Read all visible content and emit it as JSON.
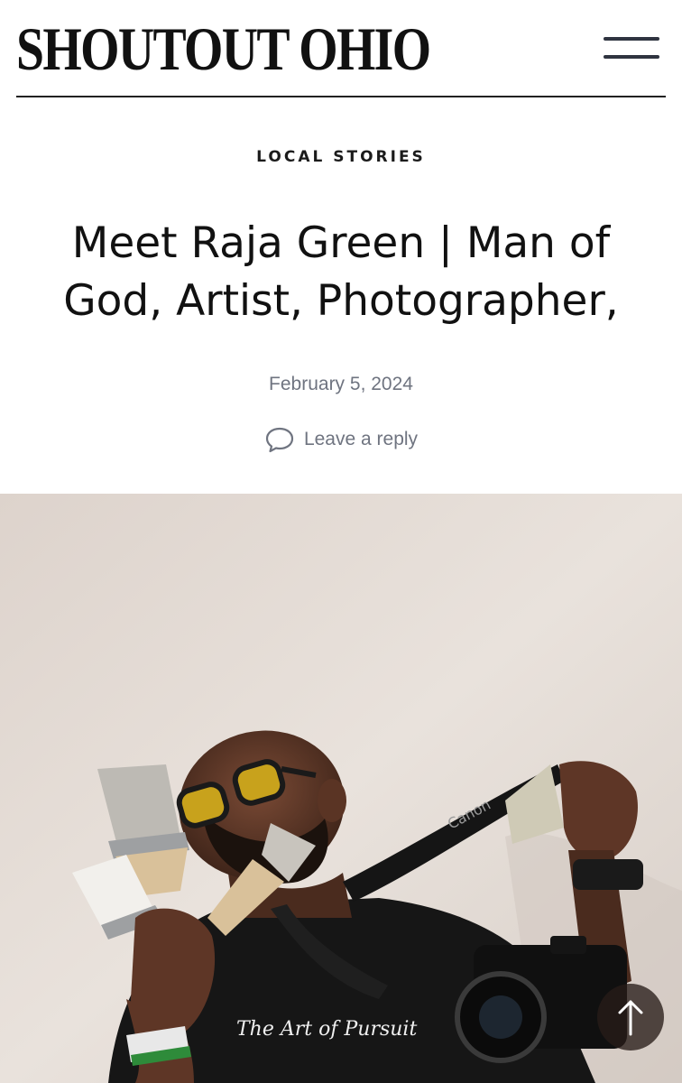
{
  "site": {
    "logo_text": "SHOUTOUT OHIO"
  },
  "header": {
    "menu_icon": "hamburger-menu-icon"
  },
  "article": {
    "category": "LOCAL STORIES",
    "title": "Meet Raja Green | Man of God, Artist, Photographer,",
    "date": "February 5, 2024",
    "reply_label": "Leave a reply",
    "reply_icon": "comment-bubble-icon"
  },
  "photo": {
    "shirt_text": "The Art of Pursuit",
    "strap_text": "Canon"
  },
  "back_to_top": {
    "icon": "arrow-up-icon"
  },
  "colors": {
    "text": "#111111",
    "meta_gray": "#6f7480",
    "wall": "#e8e0da",
    "back_to_top_bg": "#281c18"
  }
}
